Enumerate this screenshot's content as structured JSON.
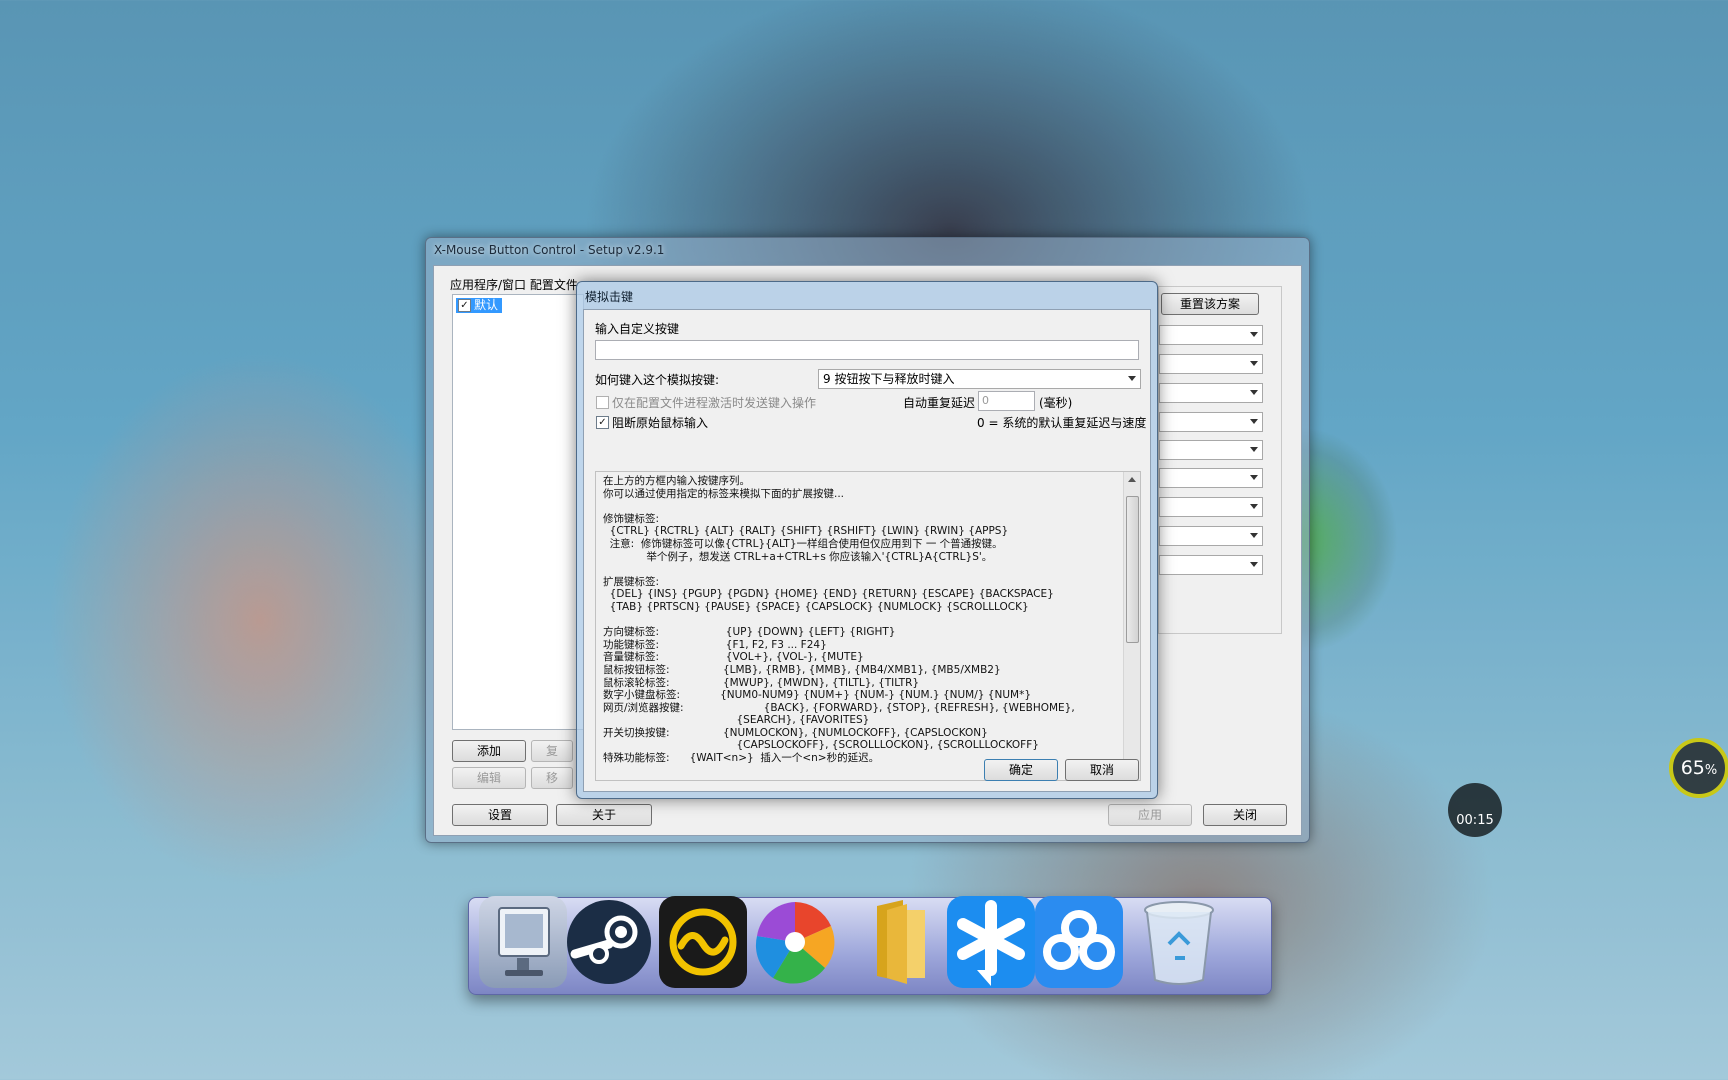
{
  "main_window": {
    "title": "X-Mouse Button Control - Setup v2.9.1",
    "profiles_label": "应用程序/窗口 配置文件",
    "profile_item": "默认",
    "profile_checked": "✓",
    "add_button": "添加",
    "copy_button": "复",
    "edit_button": "编辑",
    "move_button": "移",
    "reset_button": "重置该方案",
    "settings_button": "设置",
    "about_button": "关于",
    "apply_button": "应用",
    "close_button": "关闭"
  },
  "dialog": {
    "title": "模拟击键",
    "input_label": "输入自定义按键",
    "input_value": "",
    "how_label": "如何键入这个模拟按键:",
    "how_selected": "9 按钮按下与释放时键入",
    "only_active_label": "仅在配置文件进程激活时发送键入操作",
    "block_label": "阻断原始鼠标输入",
    "block_checked": "✓",
    "auto_repeat_label": "自动重复延迟",
    "auto_repeat_value": "0",
    "ms_label": "(毫秒)",
    "repeat_note": "0 = 系统的默认重复延迟与速度",
    "help_text": "在上方的方框内输入按键序列。\n你可以通过使用指定的标签来模拟下面的扩展按键...\n\n修饰键标签:\n  {CTRL} {RCTRL} {ALT} {RALT} {SHIFT} {RSHIFT} {LWIN} {RWIN} {APPS}\n  注意:  修饰键标签可以像{CTRL}{ALT}一样组合使用但仅应用到下 一 个普通按键。\n             举个例子，想发送 CTRL+a+CTRL+s 你应该输入'{CTRL}A{CTRL}S'。\n\n扩展键标签:\n  {DEL} {INS} {PGUP} {PGDN} {HOME} {END} {RETURN} {ESCAPE} {BACKSPACE}\n  {TAB} {PRTSCN} {PAUSE} {SPACE} {CAPSLOCK} {NUMLOCK} {SCROLLLOCK}\n\n方向键标签:                    {UP} {DOWN} {LEFT} {RIGHT}\n功能键标签:                    {F1, F2, F3 ... F24}\n音量键标签:                    {VOL+}, {VOL-}, {MUTE}\n鼠标按钮标签:                {LMB}, {RMB}, {MMB}, {MB4/XMB1}, {MB5/XMB2}\n鼠标滚轮标签:                {MWUP}, {MWDN}, {TILTL}, {TILTR}\n数字小键盘标签:            {NUM0-NUM9} {NUM+} {NUM-} {NUM.} {NUM/} {NUM*}\n网页/浏览器按键:                        {BACK}, {FORWARD}, {STOP}, {REFRESH}, {WEBHOME},\n                                        {SEARCH}, {FAVORITES}\n开关切换按键:                {NUMLOCKON}, {NUMLOCKOFF}, {CAPSLOCKON}\n                                        {CAPSLOCKOFF}, {SCROLLLOCKON}, {SCROLLLOCKOFF}\n特殊功能标签:      {WAIT<n>}  插入一个<n>秒的延迟。",
    "ok_button": "确定",
    "cancel_button": "取消"
  },
  "hud": {
    "battery_percent": "65",
    "percent_sign": "%",
    "timer": "00:15"
  },
  "dock": {
    "icons": [
      "computer-icon",
      "steam-icon",
      "wave-app-icon",
      "pinwheel-icon",
      "folder-icon",
      "chat-icon",
      "cloud-icon",
      "recycle-bin-icon"
    ]
  },
  "colors": {
    "selection": "#3399ff",
    "dock": "#9da6da",
    "hud_ring": "#c8c818"
  }
}
